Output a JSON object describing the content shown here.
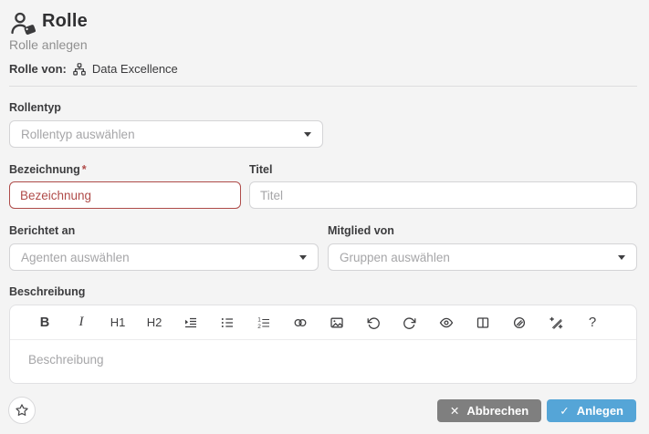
{
  "header": {
    "title": "Rolle",
    "title_icon": "user-tag-icon",
    "subtitle": "Rolle anlegen",
    "owner": {
      "label": "Rolle von:",
      "icon": "sitemap-icon",
      "value": "Data Excellence"
    }
  },
  "form": {
    "rollentyp": {
      "label": "Rollentyp",
      "placeholder": "Rollentyp auswählen",
      "type": "dropdown"
    },
    "bezeichnung": {
      "label": "Bezeichnung",
      "required_marker": "*",
      "placeholder": "Bezeichnung",
      "state": "error"
    },
    "titel": {
      "label": "Titel",
      "placeholder": "Titel"
    },
    "berichtet_an": {
      "label": "Berichtet an",
      "placeholder": "Agenten auswählen",
      "type": "dropdown"
    },
    "mitglied_von": {
      "label": "Mitglied von",
      "placeholder": "Gruppen auswählen",
      "type": "dropdown"
    },
    "beschreibung": {
      "label": "Beschreibung",
      "placeholder": "Beschreibung",
      "type": "richtext"
    }
  },
  "editor_toolbar": {
    "items": [
      {
        "name": "bold",
        "label": "B"
      },
      {
        "name": "italic",
        "label": "I"
      },
      {
        "name": "heading-1",
        "label": "H1"
      },
      {
        "name": "heading-2",
        "label": "H2"
      },
      {
        "name": "indent"
      },
      {
        "name": "bullet-list"
      },
      {
        "name": "ordered-list"
      },
      {
        "name": "link"
      },
      {
        "name": "image"
      },
      {
        "name": "undo"
      },
      {
        "name": "redo"
      },
      {
        "name": "preview"
      },
      {
        "name": "table"
      },
      {
        "name": "attachment"
      },
      {
        "name": "magic-wand"
      },
      {
        "name": "help",
        "label": "?"
      }
    ]
  },
  "footer": {
    "favorite_icon": "star-icon",
    "cancel": {
      "label": "Abbrechen",
      "icon_glyph": "✕"
    },
    "submit": {
      "label": "Anlegen",
      "icon_glyph": "✓"
    }
  },
  "colors": {
    "background": "#f4f4f4",
    "error_red": "#b04b49",
    "accent_blue": "#55a5d7",
    "cancel_gray": "#7f7f7f",
    "text_dark": "#3c3c3e",
    "placeholder_gray": "#a6a6a8"
  }
}
